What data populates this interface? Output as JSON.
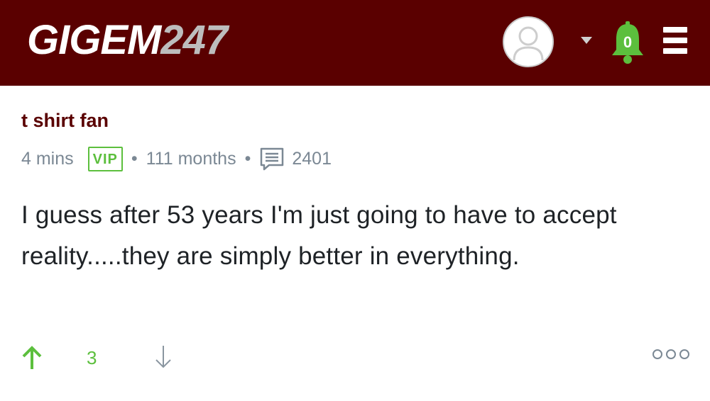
{
  "header": {
    "logo_main": "GIGEM",
    "logo_num": "247",
    "notification_count": "0",
    "icons": {
      "avatar": "user-avatar-icon",
      "dropdown": "chevron-down-icon",
      "notifications": "bell-icon",
      "menu": "hamburger-menu-icon"
    },
    "colors": {
      "bar": "#5a0000",
      "bell": "#5cbf3d"
    }
  },
  "post": {
    "author": "t shirt fan",
    "time": "4 mins",
    "badge": "VIP",
    "tenure": "111 months",
    "reply_count": "2401",
    "text": "I guess after 53 years I'm just going to have to accept reality.....they are simply better in everything."
  },
  "actions": {
    "upvote_icon": "arrow-up-icon",
    "vote_count": "3",
    "downvote_icon": "arrow-down-icon",
    "more_icon": "more-options-icon"
  }
}
